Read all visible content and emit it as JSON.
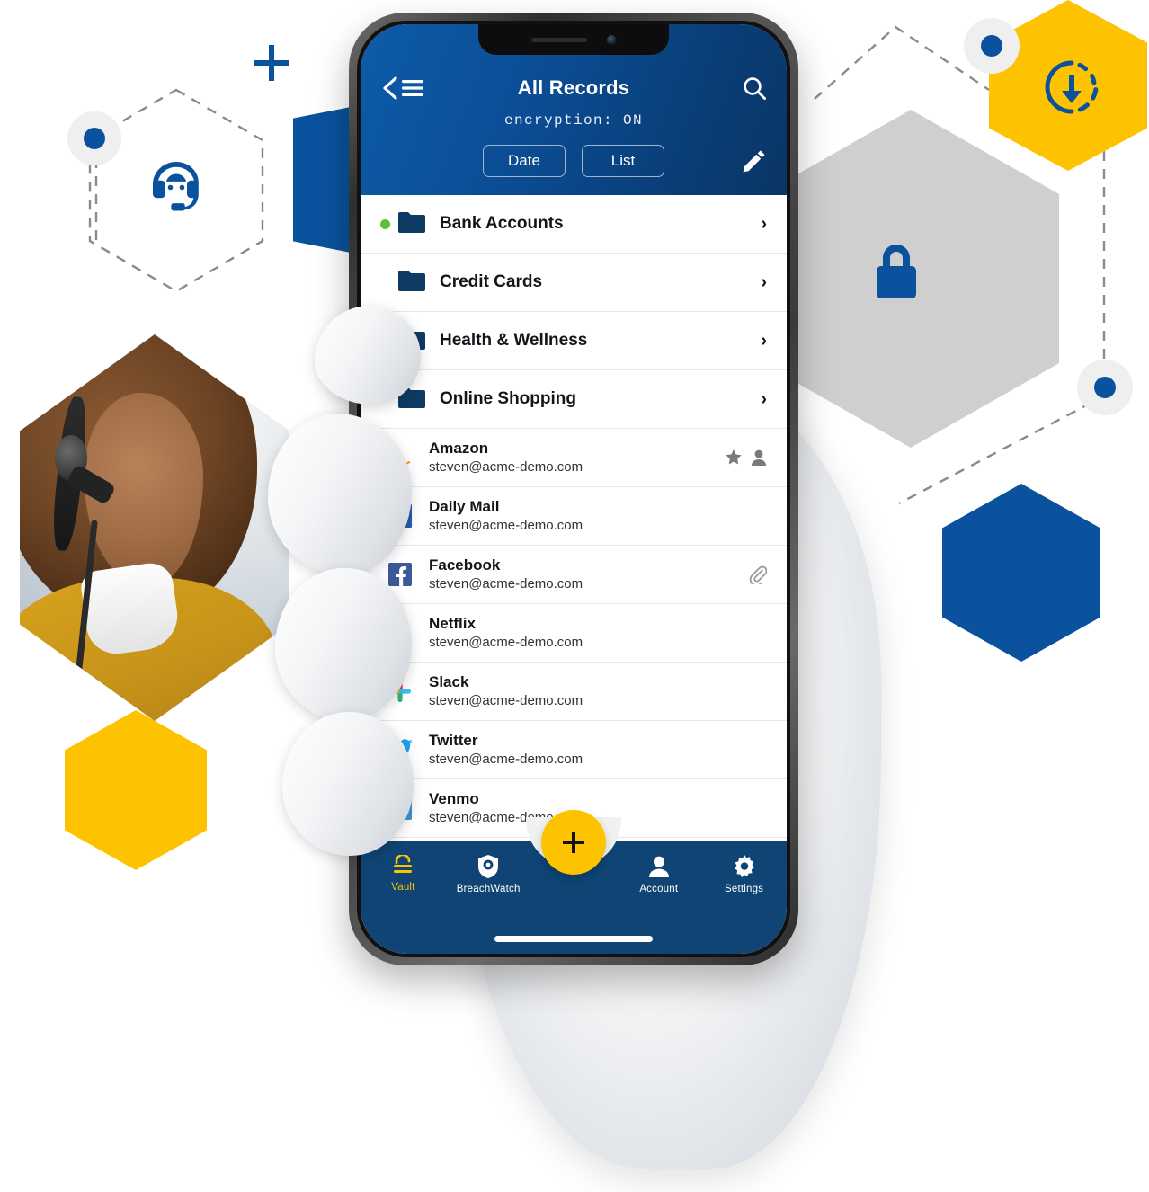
{
  "app": {
    "header": {
      "title": "All Records",
      "encryption_status": "encryption: ON",
      "back_icon": "back-chevron-icon",
      "menu_icon": "hamburger-menu-icon",
      "search_icon": "search-icon",
      "edit_icon": "pencil-edit-icon",
      "sort_button": "Date",
      "view_button": "List"
    },
    "folders": [
      {
        "name": "Bank Accounts",
        "status_color": "#5BC236",
        "has_status": true,
        "chevron": "›"
      },
      {
        "name": "Credit Cards",
        "status_color": "transparent",
        "has_status": false,
        "chevron": "›"
      },
      {
        "name": "Health & Wellness",
        "status_color": "#22B2E8",
        "has_status": true,
        "chevron": "›"
      },
      {
        "name": "Online Shopping",
        "status_color": "transparent",
        "has_status": false,
        "chevron": "›"
      }
    ],
    "records": [
      {
        "title": "Amazon",
        "subtitle": "steven@acme-demo.com",
        "icon": "amazon-logo-icon",
        "badges": [
          "favorite-star-icon",
          "shared-person-icon"
        ]
      },
      {
        "title": "Daily Mail",
        "subtitle": "steven@acme-demo.com",
        "icon": "dailymail-logo-icon",
        "badges": []
      },
      {
        "title": "Facebook",
        "subtitle": "steven@acme-demo.com",
        "icon": "facebook-logo-icon",
        "badges": [
          "attachment-paperclip-icon"
        ]
      },
      {
        "title": "Netflix",
        "subtitle": "steven@acme-demo.com",
        "icon": "netflix-logo-icon",
        "badges": []
      },
      {
        "title": "Slack",
        "subtitle": "steven@acme-demo.com",
        "icon": "slack-logo-icon",
        "badges": []
      },
      {
        "title": "Twitter",
        "subtitle": "steven@acme-demo.com",
        "icon": "twitter-logo-icon",
        "badges": []
      },
      {
        "title": "Venmo",
        "subtitle": "steven@acme-demo.com",
        "icon": "venmo-logo-icon",
        "badges": []
      }
    ],
    "tabbar": {
      "add_button_label": "+",
      "items": [
        {
          "label": "Vault",
          "icon": "vault-lock-icon",
          "active": true
        },
        {
          "label": "BreachWatch",
          "icon": "breachwatch-shield-icon",
          "active": false
        },
        {
          "label": "",
          "icon": "add-record-fab",
          "active": false
        },
        {
          "label": "Account",
          "icon": "account-person-icon",
          "active": false
        },
        {
          "label": "Settings",
          "icon": "settings-gear-icon",
          "active": false
        }
      ]
    }
  },
  "decorations": {
    "plus_mark": "plus-mark-icon",
    "hexagons": [
      {
        "name": "support-agent-hexagon-dashed",
        "icon": "headset-support-icon",
        "fill": "none",
        "outline": "dashed"
      },
      {
        "name": "support-agent-photo-hexagon",
        "icon": "customer-support-photo",
        "fill": "photo",
        "outline": "none"
      },
      {
        "name": "yellow-hexagon-plain",
        "icon": "",
        "fill": "#FDC300",
        "outline": "none"
      },
      {
        "name": "blue-banner-left",
        "icon": "",
        "fill": "#0A529E",
        "outline": "none"
      },
      {
        "name": "gray-hexagon-lock",
        "icon": "padlock-icon",
        "fill": "#CFCFCF",
        "outline": "none"
      },
      {
        "name": "yellow-hexagon-sync",
        "icon": "download-sync-icon",
        "fill": "#FDC300",
        "outline": "none"
      },
      {
        "name": "blue-hexagon-plain",
        "icon": "",
        "fill": "#0A529E",
        "outline": "none"
      }
    ]
  },
  "colors": {
    "brand_blue": "#0A529E",
    "deep_navy": "#0F4474",
    "accent_yellow": "#FDC300",
    "status_green": "#5BC236",
    "status_cyan": "#22B2E8",
    "hex_gray": "#CFCFCF",
    "node_gray": "#EFEFEF",
    "dash_gray": "#8A8A8A"
  }
}
